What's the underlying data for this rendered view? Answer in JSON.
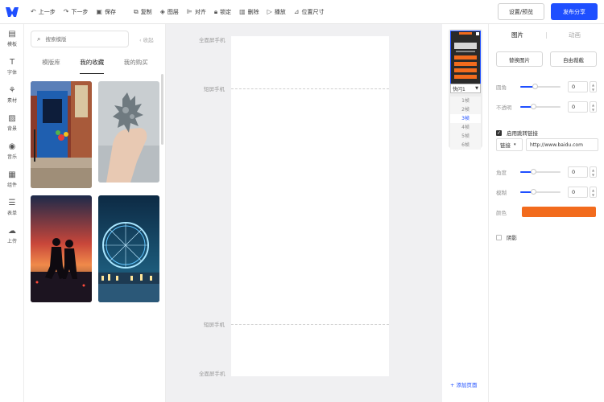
{
  "toolbar": {
    "undo": "上一步",
    "redo": "下一步",
    "save": "保存",
    "copy": "复制",
    "layer": "图层",
    "align": "对齐",
    "lock": "锁定",
    "delete": "删除",
    "play": "播放",
    "position_size": "位置尺寸",
    "settings_preview": "设置/预览",
    "publish_share": "发布分享"
  },
  "rail": [
    {
      "label": "模板",
      "icon": "template-icon"
    },
    {
      "label": "字体",
      "icon": "font-icon"
    },
    {
      "label": "素材",
      "icon": "material-icon"
    },
    {
      "label": "背景",
      "icon": "background-icon"
    },
    {
      "label": "音乐",
      "icon": "music-icon"
    },
    {
      "label": "组件",
      "icon": "component-icon"
    },
    {
      "label": "表单",
      "icon": "form-icon"
    },
    {
      "label": "上传",
      "icon": "upload-icon"
    }
  ],
  "panel": {
    "search_placeholder": "搜索模版",
    "collapse": "收起",
    "tabs": [
      "模版库",
      "我的收藏",
      "我的购买"
    ],
    "active_tab": 1
  },
  "canvas": {
    "full_screen_top": "全面屏手机",
    "short_screen_top": "短屏手机",
    "short_screen_bottom": "短屏手机",
    "full_screen_bottom": "全面屏手机"
  },
  "strip": {
    "select_value": "快闪1",
    "pages": [
      "1帧",
      "2帧",
      "3帧",
      "4帧",
      "5帧",
      "6帧"
    ],
    "active_page": 2,
    "add_page": "+ 添加页面"
  },
  "props": {
    "tabs": [
      "图片",
      "动画"
    ],
    "replace_image": "替换图片",
    "free_crop": "自由裁截",
    "radius_label": "圆角",
    "radius_value": "0",
    "opacity_label": "不透明",
    "opacity_value": "0",
    "enable_link": "启用跳转链接",
    "link_type": "链接",
    "link_url": "http://www.baidu.com",
    "angle_label": "角度",
    "angle_value": "0",
    "blur_label": "模糊",
    "blur_value": "0",
    "color_label": "颜色",
    "color_value": "#f26b1d",
    "shadow_label": "阴影"
  },
  "colors": {
    "accent": "#1f4fff",
    "orange": "#f26b1d"
  }
}
